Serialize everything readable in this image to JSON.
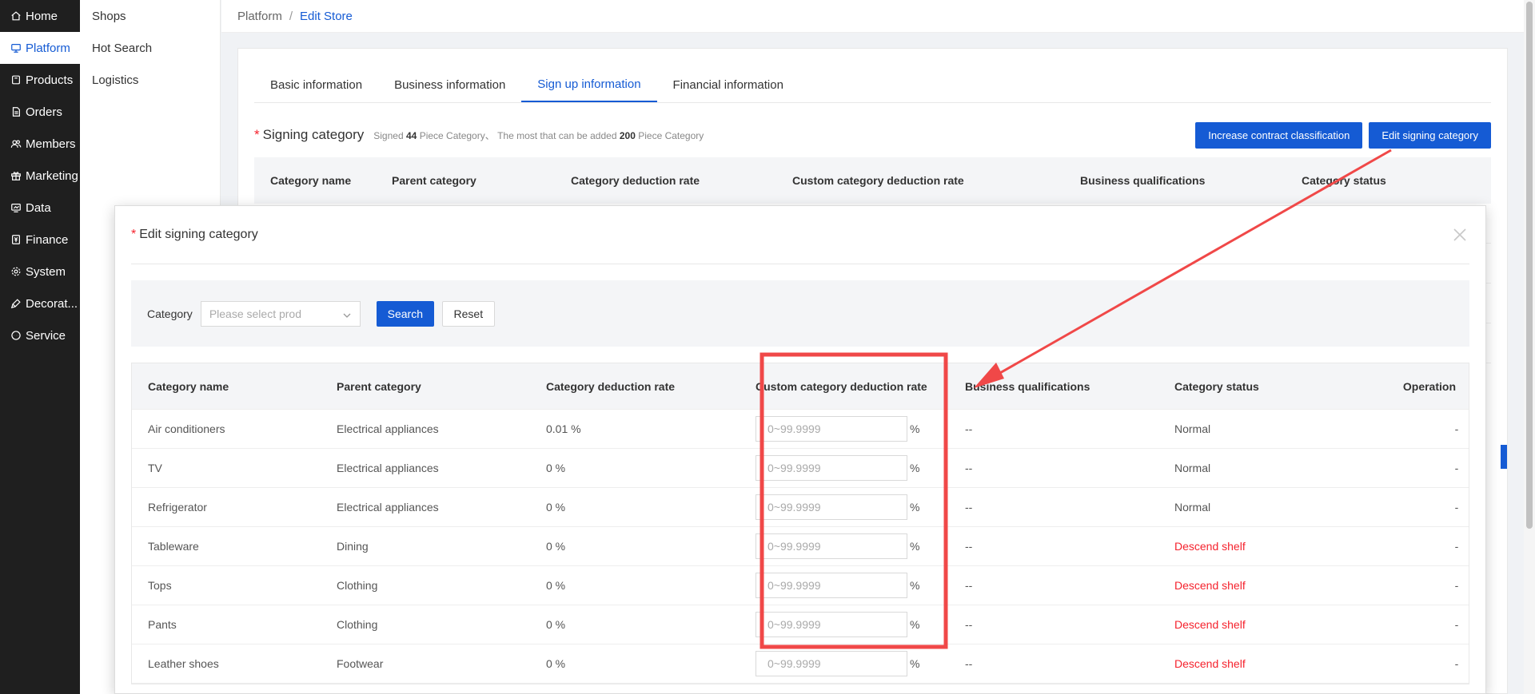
{
  "sidebar": {
    "items": [
      {
        "label": "Home",
        "icon": "home-icon"
      },
      {
        "label": "Platform",
        "icon": "monitor-icon",
        "active": true
      },
      {
        "label": "Products",
        "icon": "box-icon"
      },
      {
        "label": "Orders",
        "icon": "document-icon"
      },
      {
        "label": "Members",
        "icon": "users-icon"
      },
      {
        "label": "Marketing",
        "icon": "gift-icon"
      },
      {
        "label": "Data",
        "icon": "chart-icon"
      },
      {
        "label": "Finance",
        "icon": "finance-icon"
      },
      {
        "label": "System",
        "icon": "gear-icon"
      },
      {
        "label": "Decorat...",
        "icon": "brush-icon"
      },
      {
        "label": "Service",
        "icon": "chat-icon"
      }
    ]
  },
  "subnav": {
    "items": [
      {
        "label": "Shops"
      },
      {
        "label": "Hot Search"
      },
      {
        "label": "Logistics"
      }
    ]
  },
  "breadcrumb": {
    "root": "Platform",
    "sep": "/",
    "current": "Edit Store"
  },
  "tabs": [
    {
      "label": "Basic information"
    },
    {
      "label": "Business information"
    },
    {
      "label": "Sign up information",
      "active": true
    },
    {
      "label": "Financial information"
    }
  ],
  "section": {
    "required_mark": "*",
    "title": "Signing category",
    "info_prefix": "Signed",
    "signed_count": "44",
    "info_mid": "Piece Category、 The most that can be added",
    "max_count": "200",
    "info_suffix": "Piece Category",
    "btn_increase": "Increase contract classification",
    "btn_edit": "Edit signing category"
  },
  "bg_table": {
    "headers": [
      "Category name",
      "Parent category",
      "Category deduction rate",
      "Custom category deduction rate",
      "Business qualifications",
      "Category status"
    ]
  },
  "modal": {
    "required_mark": "*",
    "title": "Edit signing category",
    "filter": {
      "label": "Category",
      "placeholder": "Please select prod",
      "search": "Search",
      "reset": "Reset"
    },
    "headers": [
      "Category name",
      "Parent category",
      "Category deduction rate",
      "Custom category deduction rate",
      "Business qualifications",
      "Category status",
      "Operation"
    ],
    "input_placeholder": "0~99.9999",
    "pct": "%",
    "rows": [
      {
        "name": "Air conditioners",
        "parent": "Electrical appliances",
        "rate": "0.01 %",
        "qual": "--",
        "status": "Normal",
        "status_color": "#555555",
        "op": "-"
      },
      {
        "name": "TV",
        "parent": "Electrical appliances",
        "rate": "0 %",
        "qual": "--",
        "status": "Normal",
        "status_color": "#555555",
        "op": "-"
      },
      {
        "name": "Refrigerator",
        "parent": "Electrical appliances",
        "rate": "0 %",
        "qual": "--",
        "status": "Normal",
        "status_color": "#555555",
        "op": "-"
      },
      {
        "name": "Tableware",
        "parent": "Dining",
        "rate": "0 %",
        "qual": "--",
        "status": "Descend shelf",
        "status_color": "#f5222d",
        "op": "-"
      },
      {
        "name": "Tops",
        "parent": "Clothing",
        "rate": "0 %",
        "qual": "--",
        "status": "Descend shelf",
        "status_color": "#f5222d",
        "op": "-"
      },
      {
        "name": "Pants",
        "parent": "Clothing",
        "rate": "0 %",
        "qual": "--",
        "status": "Descend shelf",
        "status_color": "#f5222d",
        "op": "-"
      },
      {
        "name": "Leather shoes",
        "parent": "Footwear",
        "rate": "0 %",
        "qual": "--",
        "status": "Descend shelf",
        "status_color": "#f5222d",
        "op": "-"
      }
    ]
  },
  "colors": {
    "accent": "#155bd4",
    "annotation": "#f04848",
    "danger": "#f5222d"
  }
}
